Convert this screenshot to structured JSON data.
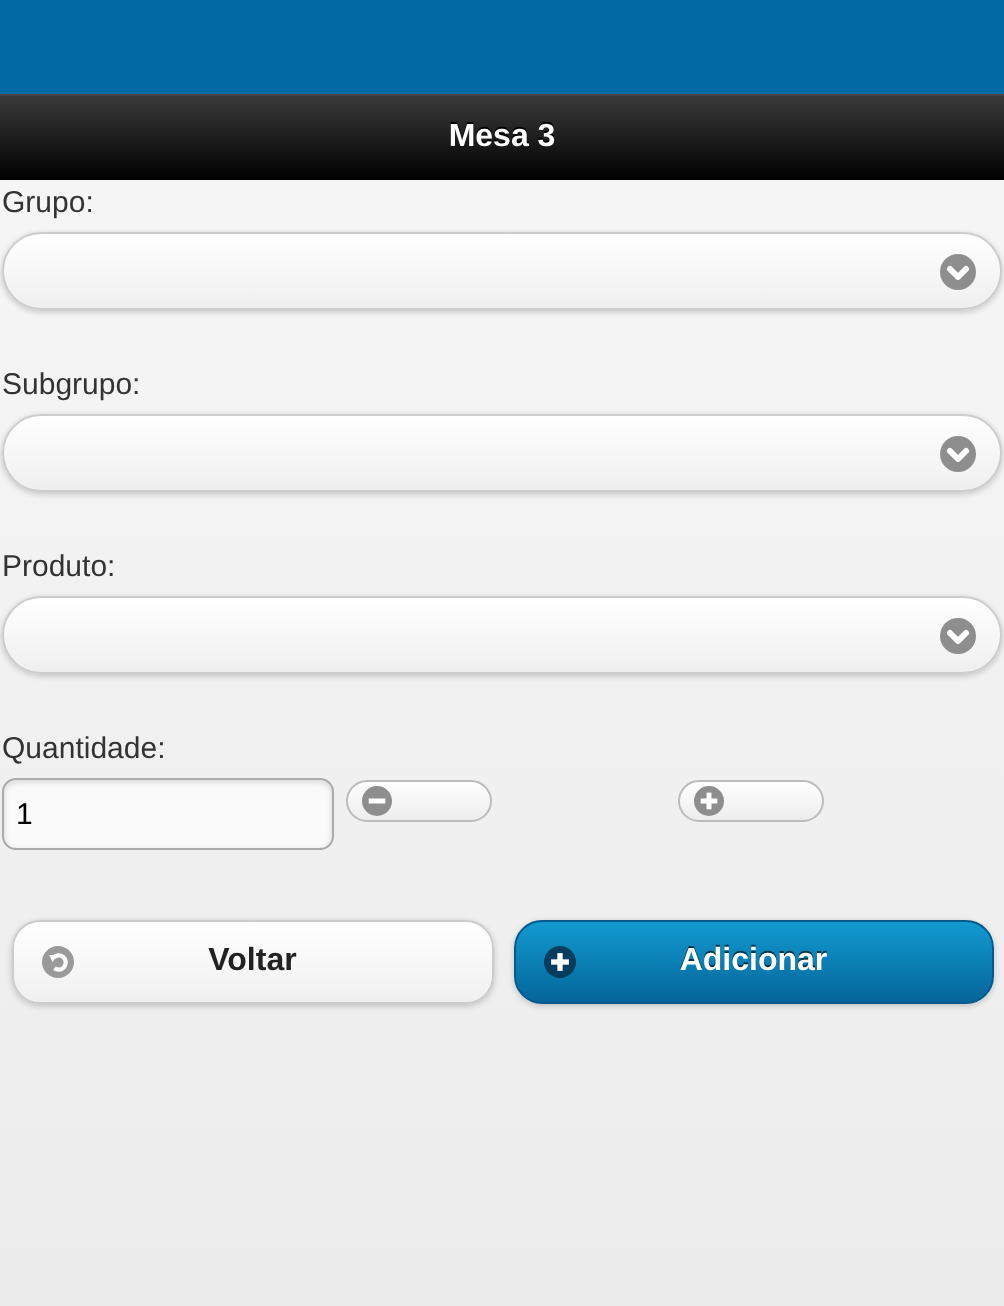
{
  "header": {
    "title": "Mesa 3"
  },
  "selects": [
    {
      "label": "Grupo:"
    },
    {
      "label": "Subgrupo:"
    },
    {
      "label": "Produto:"
    }
  ],
  "quantity": {
    "label": "Quantidade:",
    "value": "1"
  },
  "actions": [
    {
      "kind": "back",
      "label": "Voltar"
    },
    {
      "kind": "add",
      "label": "Adicionar"
    }
  ]
}
